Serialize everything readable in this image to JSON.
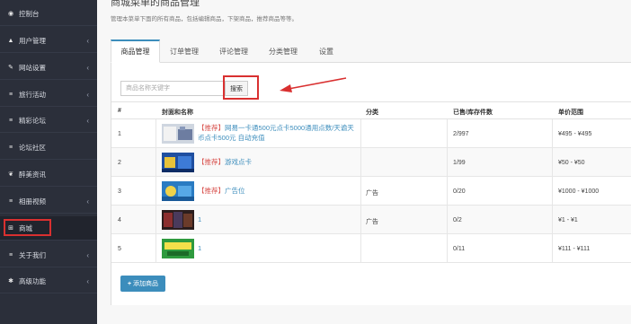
{
  "sidebar": {
    "items": [
      {
        "icon": "dashboard-icon",
        "glyph": "◉",
        "label": "控制台",
        "has_children": false
      },
      {
        "icon": "user-icon",
        "glyph": "▲",
        "label": "用户管理",
        "has_children": true
      },
      {
        "icon": "wrench-icon",
        "glyph": "✎",
        "label": "网站设置",
        "has_children": true
      },
      {
        "icon": "list-icon",
        "glyph": "≡",
        "label": "旅行活动",
        "has_children": true
      },
      {
        "icon": "list-icon",
        "glyph": "≡",
        "label": "精彩论坛",
        "has_children": true
      },
      {
        "icon": "list-icon",
        "glyph": "≡",
        "label": "论坛社区",
        "has_children": false
      },
      {
        "icon": "leaf-icon",
        "glyph": "❦",
        "label": "醉美资讯",
        "has_children": false
      },
      {
        "icon": "list-icon",
        "glyph": "≡",
        "label": "相册视频",
        "has_children": true
      },
      {
        "icon": "cart-icon",
        "glyph": "⊞",
        "label": "商城",
        "has_children": false
      },
      {
        "icon": "list-icon",
        "glyph": "≡",
        "label": "关于我们",
        "has_children": true
      },
      {
        "icon": "gear-icon",
        "glyph": "✱",
        "label": "高级功能",
        "has_children": true
      }
    ]
  },
  "page": {
    "title": "商城菜单的商品管理",
    "description": "管理本菜单下面的所有商品，包括编辑商品，下架商品，推荐商品等等。"
  },
  "tabs": [
    "商品管理",
    "订单管理",
    "评论管理",
    "分类管理",
    "设置"
  ],
  "search": {
    "placeholder": "商品名称关键字",
    "button": "搜索"
  },
  "table": {
    "columns": [
      "#",
      "封面和名称",
      "分类",
      "已售/库存件数",
      "单价范围"
    ],
    "rows": [
      {
        "id": "1",
        "tag": "【推荐】",
        "name": "网易一卡通500元点卡5000通用点数/天谕天币点卡500元 自动充值",
        "category": "",
        "stock": "2/997",
        "price": "¥495 - ¥495"
      },
      {
        "id": "2",
        "tag": "【推荐】",
        "name": "游戏点卡",
        "category": "",
        "stock": "1/99",
        "price": "¥50 - ¥50"
      },
      {
        "id": "3",
        "tag": "【推荐】",
        "name": "广告位",
        "category": "广告",
        "stock": "0/20",
        "price": "¥1000 - ¥1000"
      },
      {
        "id": "4",
        "tag": "",
        "name": "1",
        "category": "广告",
        "stock": "0/2",
        "price": "¥1 - ¥1"
      },
      {
        "id": "5",
        "tag": "",
        "name": "1",
        "category": "",
        "stock": "0/11",
        "price": "¥111 - ¥111"
      }
    ]
  },
  "add_button": {
    "icon": "plus-icon",
    "label": "添加商品"
  },
  "colors": {
    "sidebar_bg": "#2b2f3a",
    "accent": "#3c8dbc",
    "highlight": "#d93030",
    "recommend": "#d9534f"
  }
}
